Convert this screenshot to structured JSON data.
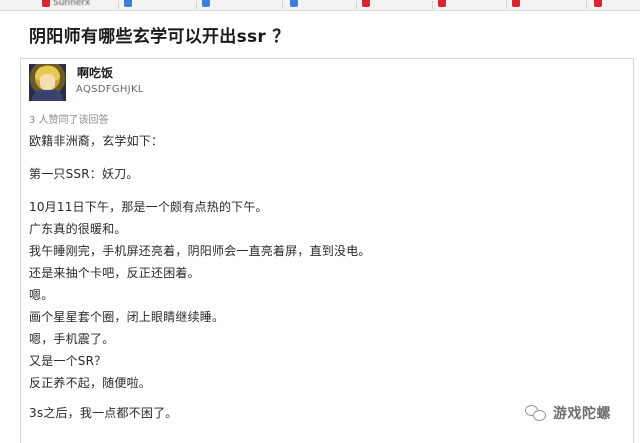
{
  "bookmarks": [
    {
      "label": "Sunnerx",
      "color": "#d9232d"
    },
    {
      "label": "",
      "color": "#3b7fd9"
    },
    {
      "label": "",
      "color": "#3b7fd9"
    },
    {
      "label": "",
      "color": "#3b7fd9"
    },
    {
      "label": "",
      "color": "#d9232d"
    },
    {
      "label": "",
      "color": "#d9232d"
    },
    {
      "label": "",
      "color": "#d9232d"
    },
    {
      "label": "",
      "color": "#d9232d"
    }
  ],
  "question": {
    "title": "阴阳师有哪些玄学可以开出ssr ？"
  },
  "answer": {
    "author_name": "啊吃饭",
    "author_bio": "AQSDFGHJKL",
    "vote_text": "3 人赞同了该回答",
    "paragraphs": [
      "欧籍非洲裔，玄学如下：",
      "第一只SSR：妖刀。",
      "10月11日下午，那是一个颇有点热的下午。",
      "广东真的很暖和。",
      "我午睡刚完，手机屏还亮着，阴阳师会一直亮着屏，直到没电。",
      "还是来抽个卡吧，反正还困着。",
      "嗯。",
      "画个星星套个圈，闭上眼睛继续睡。",
      "嗯，手机震了。",
      "又是一个SR？",
      "反正养不起，随便啦。",
      "3s之后，我一点都不困了。"
    ]
  },
  "watermark": {
    "text": "游戏陀螺",
    "icon": "wechat-icon"
  }
}
